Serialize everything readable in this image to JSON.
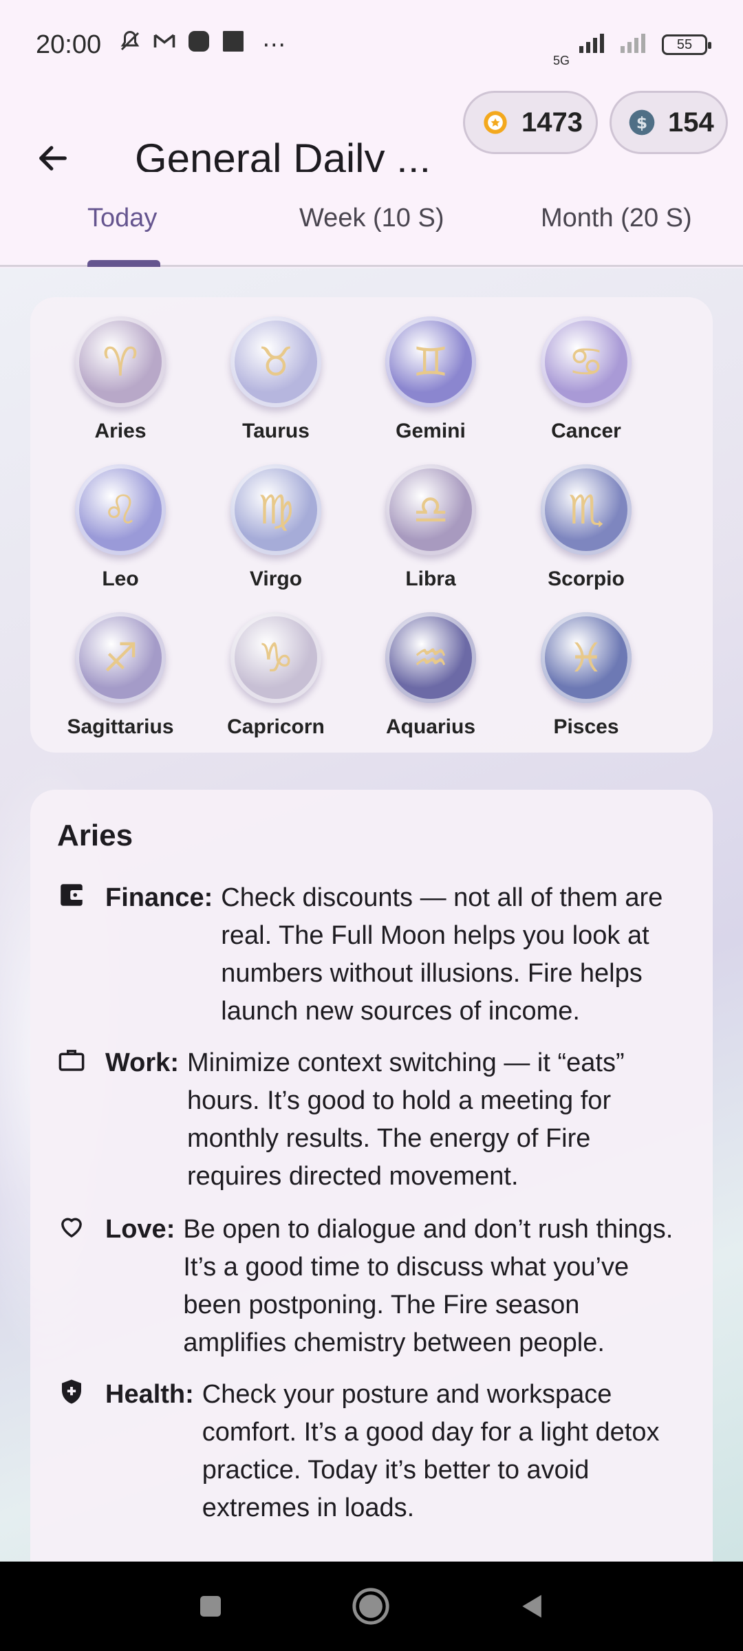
{
  "status_bar": {
    "time": "20:00",
    "network": "5G",
    "battery": "55"
  },
  "app_bar": {
    "title": "General Daily ...",
    "score": "1473",
    "coins": "154"
  },
  "tabs": [
    {
      "label": "Today"
    },
    {
      "label": "Week (10 S)"
    },
    {
      "label": "Month (20 S)"
    }
  ],
  "signs": [
    {
      "name": "Aries",
      "glyph": "♈",
      "color": "#b8a8c8"
    },
    {
      "name": "Taurus",
      "glyph": "♉",
      "color": "#b6b6de"
    },
    {
      "name": "Gemini",
      "glyph": "♊",
      "color": "#8b86cf"
    },
    {
      "name": "Cancer",
      "glyph": "♋",
      "color": "#a99ad6"
    },
    {
      "name": "Leo",
      "glyph": "♌",
      "color": "#9a9ad8"
    },
    {
      "name": "Virgo",
      "glyph": "♍",
      "color": "#a6acd8"
    },
    {
      "name": "Libra",
      "glyph": "♎",
      "color": "#a89abf"
    },
    {
      "name": "Scorpio",
      "glyph": "♏",
      "color": "#7e86bf"
    },
    {
      "name": "Sagittarius",
      "glyph": "♐",
      "color": "#a49bc8"
    },
    {
      "name": "Capricorn",
      "glyph": "♑",
      "color": "#c7bfd4"
    },
    {
      "name": "Aquarius",
      "glyph": "♒",
      "color": "#6c6aa6"
    },
    {
      "name": "Pisces",
      "glyph": "♓",
      "color": "#6d79b4"
    }
  ],
  "detail": {
    "sign": "Aries",
    "finance": {
      "label": "Finance:",
      "text": "Check discounts — not all of them are real. The Full Moon helps you look at numbers without illusions. Fire helps launch new sources of income."
    },
    "work": {
      "label": "Work:",
      "text": "Minimize context switching — it “eats” hours. It’s good to hold a meeting for monthly results. The energy of Fire requires directed movement."
    },
    "love": {
      "label": "Love:",
      "text": "Be open to dialogue and don’t rush things. It’s a good time to discuss what you’ve been postponing. The Fire season amplifies chemistry between people."
    },
    "health": {
      "label": "Health:",
      "text": "Check your posture and workspace comfort. It’s a good day for a light detox practice. Today it’s better to avoid extremes in loads."
    }
  },
  "icons": {
    "back": "arrow-left-icon",
    "score": "award-medal-icon",
    "coins": "dollar-coin-icon",
    "finance": "wallet-icon",
    "work": "briefcase-icon",
    "love": "heart-icon",
    "health": "shield-plus-icon"
  },
  "colors": {
    "accent": "#65558f",
    "coin": "#4f6f86",
    "medal": "#f3a81d"
  }
}
